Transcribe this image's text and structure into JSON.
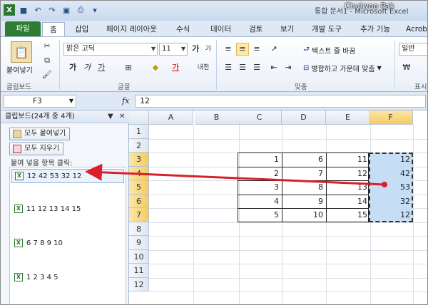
{
  "window": {
    "title": "통합 문서1 - Microsoft Excel",
    "author_overlay": "Chulwoo Pak"
  },
  "tabs": [
    "파일",
    "홈",
    "삽입",
    "페이지 레이아웃",
    "수식",
    "데이터",
    "검토",
    "보기",
    "개발 도구",
    "추가 기능",
    "Acrob"
  ],
  "ribbon": {
    "clipboard": {
      "paste_label": "붙여넣기",
      "group_label": "클립보드"
    },
    "font": {
      "font_name": "맑은 고딕",
      "font_size": "11",
      "bold": "가",
      "italic": "가",
      "underline": "가",
      "group_label": "글꼴",
      "phonetic": "내천"
    },
    "alignment": {
      "wrap_text": "텍스트 줄 바꿈",
      "merge_center": "병합하고 가운데 맞춤",
      "group_label": "맞춤"
    },
    "number": {
      "format": "일반",
      "group_label": "표시"
    }
  },
  "formula_bar": {
    "name_box": "F3",
    "fx": "fx",
    "value": "12"
  },
  "clipboard_pane": {
    "title": "클립보드(24개 중 4개)",
    "paste_all": "모두 붙여넣기",
    "clear_all": "모두 지우기",
    "hint": "붙여 넣을 항목 클릭:",
    "items": [
      "12 42 53 32 12",
      "11 12 13 14 15",
      "6 7 8 9 10",
      "1 2 3 4 5"
    ]
  },
  "sheet": {
    "columns": [
      "A",
      "B",
      "C",
      "D",
      "E",
      "F"
    ],
    "rows": [
      "1",
      "2",
      "3",
      "4",
      "5",
      "6",
      "7",
      "8",
      "9",
      "10",
      "11",
      "12"
    ],
    "selected_column": "F",
    "data_rows": [
      {
        "row": "3",
        "C": "1",
        "D": "6",
        "E": "11",
        "F": "12"
      },
      {
        "row": "4",
        "C": "2",
        "D": "7",
        "E": "12",
        "F": "42"
      },
      {
        "row": "5",
        "C": "3",
        "D": "8",
        "E": "13",
        "F": "53"
      },
      {
        "row": "6",
        "C": "4",
        "D": "9",
        "E": "14",
        "F": "32"
      },
      {
        "row": "7",
        "C": "5",
        "D": "10",
        "E": "15",
        "F": "12"
      }
    ]
  },
  "colors": {
    "arrow": "#d8202a",
    "selection": "#c6ddf6",
    "file_tab": "#2f7d32"
  }
}
